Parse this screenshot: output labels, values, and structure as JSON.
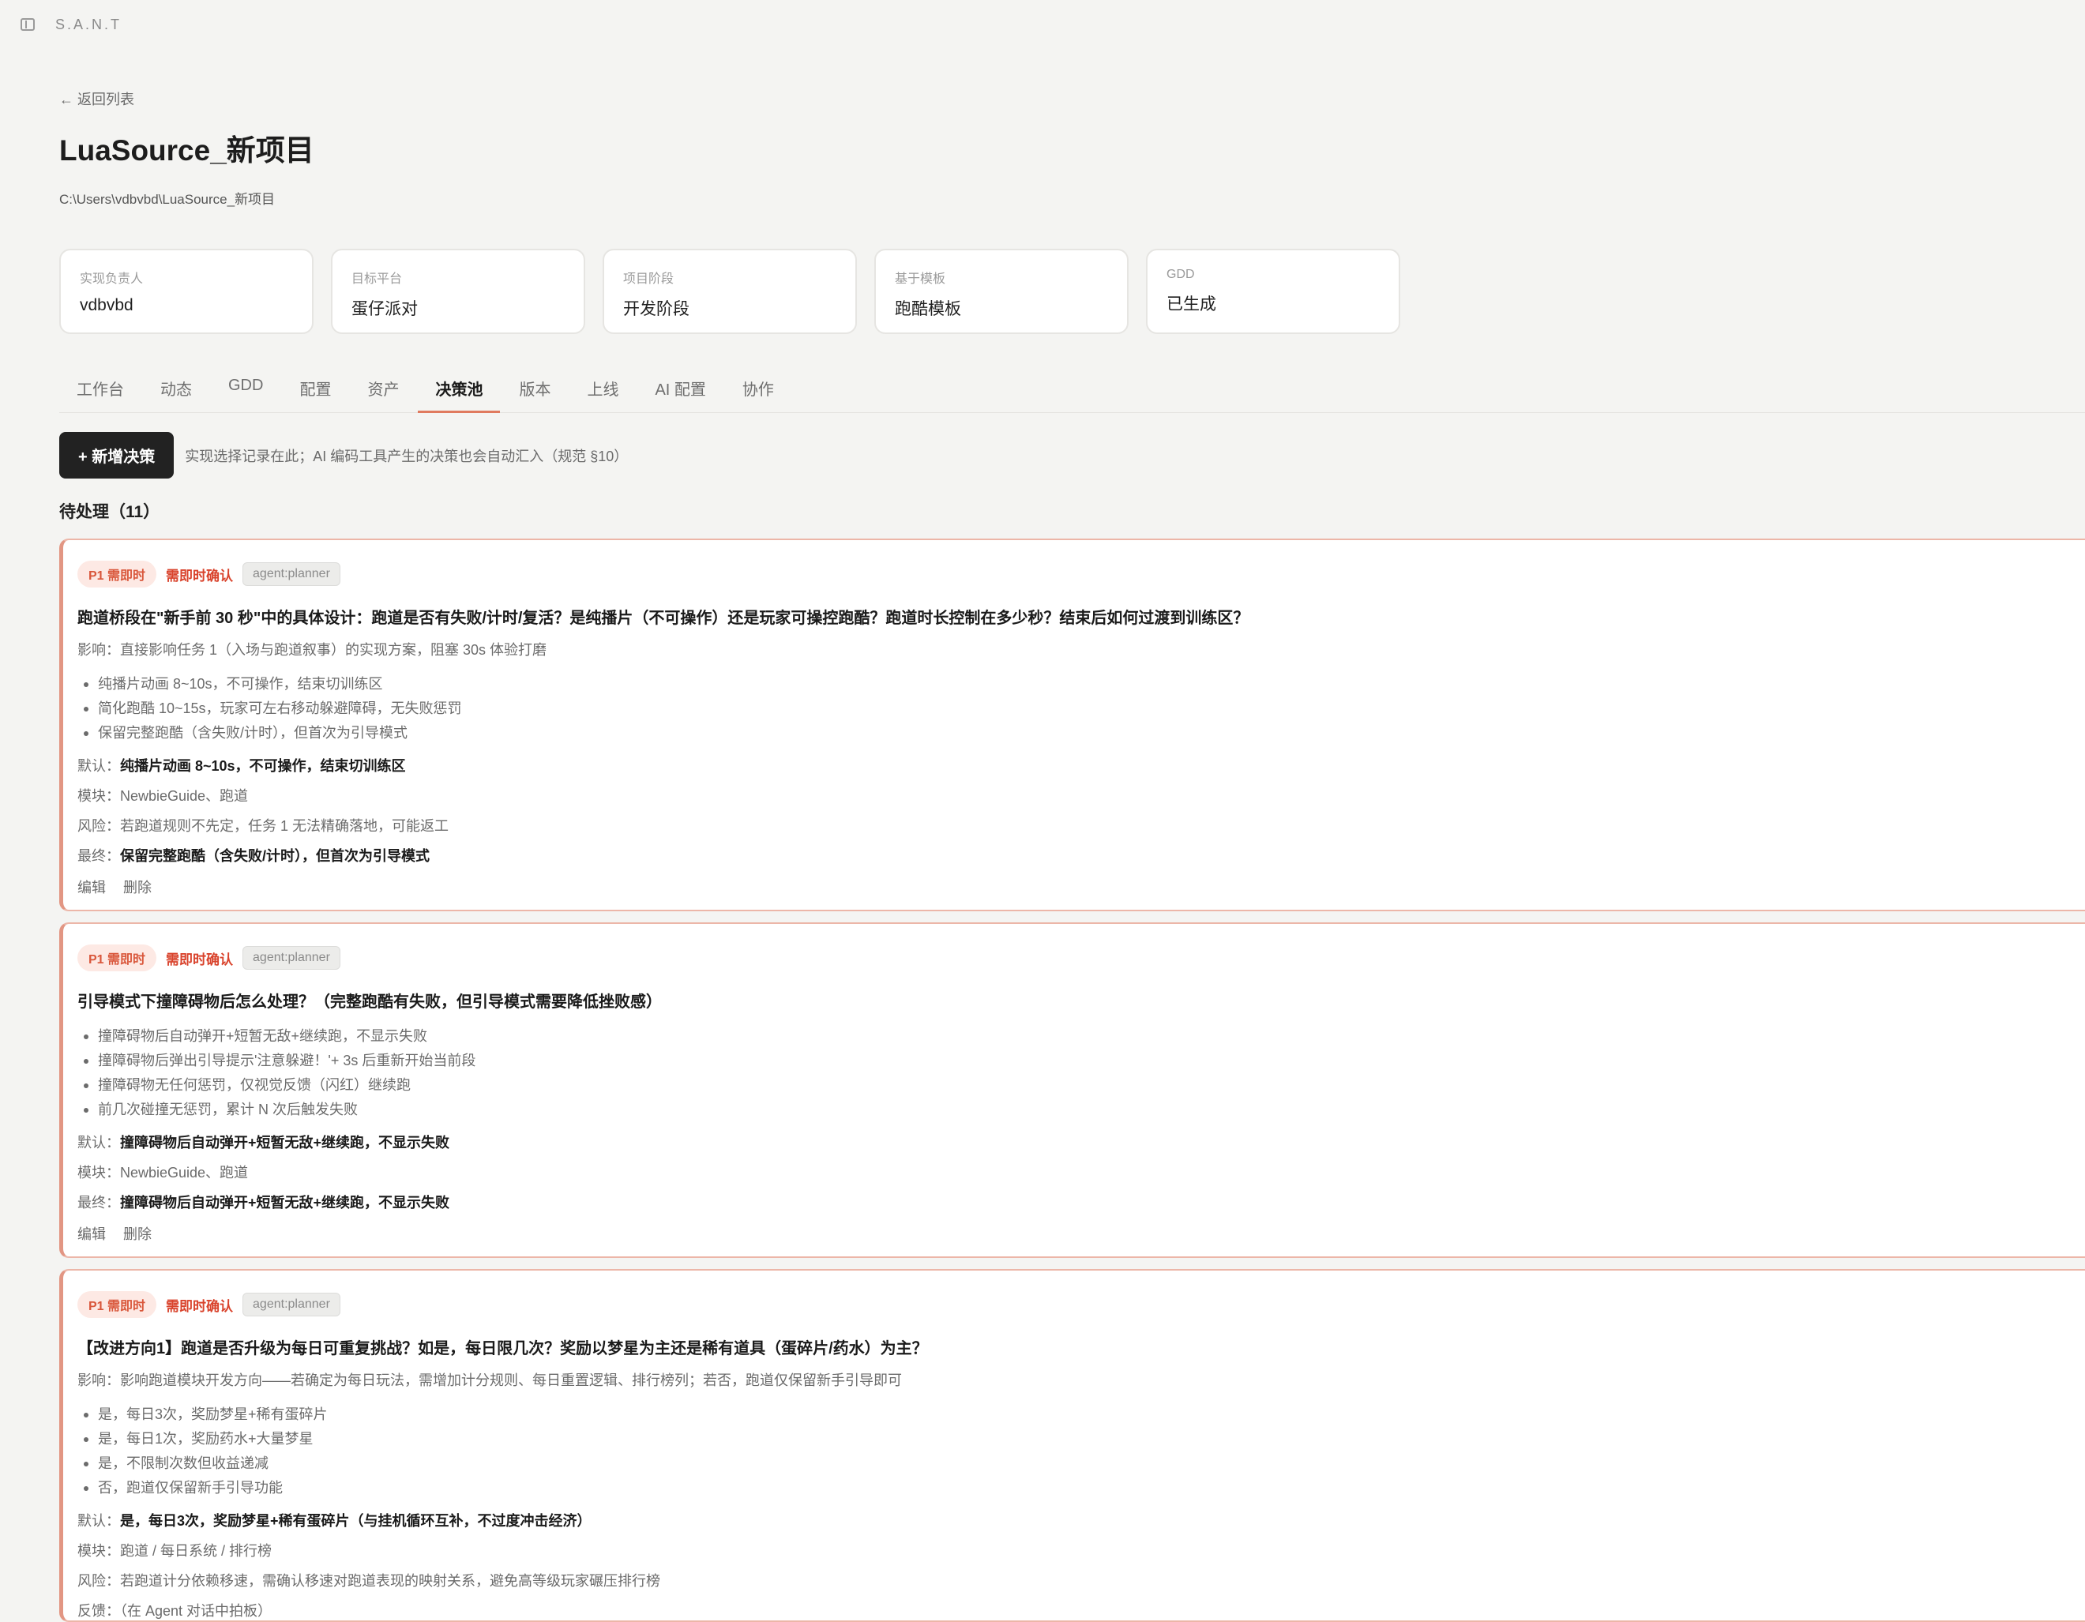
{
  "app": {
    "brand": "S.A.N.T"
  },
  "nav": {
    "back": "← 返回列表"
  },
  "project": {
    "title": "LuaSource_新项目",
    "path": "C:\\Users\\vdbvbd\\LuaSource_新项目"
  },
  "cards": [
    {
      "label": "实现负责人",
      "value": "vdbvbd"
    },
    {
      "label": "目标平台",
      "value": "蛋仔派对"
    },
    {
      "label": "项目阶段",
      "value": "开发阶段"
    },
    {
      "label": "基于模板",
      "value": "跑酷模板"
    },
    {
      "label": "GDD",
      "value": "已生成"
    }
  ],
  "tabs": [
    "工作台",
    "动态",
    "GDD",
    "配置",
    "资产",
    "决策池",
    "版本",
    "上线",
    "AI 配置",
    "协作"
  ],
  "active_tab": "决策池",
  "toolbar": {
    "add_label": "+ 新增决策",
    "hint": "实现选择记录在此；AI 编码工具产生的决策也会自动汇入（规范 §10）"
  },
  "section": {
    "pending": "待处理（11）"
  },
  "labels": {
    "impact": "影响：",
    "default": "默认：",
    "module": "模块：",
    "risk": "风险：",
    "final": "最终：",
    "feedback": "反馈：",
    "edit": "编辑",
    "delete": "删除"
  },
  "decisions": [
    {
      "priority": "P1 需即时",
      "status": "需即时确认",
      "agent": "agent:planner",
      "question": "跑道桥段在\"新手前 30 秒\"中的具体设计：跑道是否有失败/计时/复活？是纯播片（不可操作）还是玩家可操控跑酷？跑道时长控制在多少秒？结束后如何过渡到训练区？",
      "impact": "直接影响任务 1（入场与跑道叙事）的实现方案，阻塞 30s 体验打磨",
      "options": [
        "纯播片动画 8~10s，不可操作，结束切训练区",
        "简化跑酷 10~15s，玩家可左右移动躲避障碍，无失败惩罚",
        "保留完整跑酷（含失败/计时），但首次为引导模式"
      ],
      "default": "纯播片动画 8~10s，不可操作，结束切训练区",
      "module": "NewbieGuide、跑道",
      "risk": "若跑道规则不先定，任务 1 无法精确落地，可能返工",
      "final": "保留完整跑酷（含失败/计时），但首次为引导模式"
    },
    {
      "priority": "P1 需即时",
      "status": "需即时确认",
      "agent": "agent:planner",
      "question": "引导模式下撞障碍物后怎么处理？（完整跑酷有失败，但引导模式需要降低挫败感）",
      "options": [
        "撞障碍物后自动弹开+短暂无敌+继续跑，不显示失败",
        "撞障碍物后弹出引导提示'注意躲避！'+ 3s 后重新开始当前段",
        "撞障碍物无任何惩罚，仅视觉反馈（闪红）继续跑",
        "前几次碰撞无惩罚，累计 N 次后触发失败"
      ],
      "default": "撞障碍物后自动弹开+短暂无敌+继续跑，不显示失败",
      "module": "NewbieGuide、跑道",
      "final": "撞障碍物后自动弹开+短暂无敌+继续跑，不显示失败"
    },
    {
      "priority": "P1 需即时",
      "status": "需即时确认",
      "agent": "agent:planner",
      "question": "【改进方向1】跑道是否升级为每日可重复挑战？如是，每日限几次？奖励以梦星为主还是稀有道具（蛋碎片/药水）为主？",
      "impact": "影响跑道模块开发方向——若确定为每日玩法，需增加计分规则、每日重置逻辑、排行榜列；若否，跑道仅保留新手引导即可",
      "options": [
        "是，每日3次，奖励梦星+稀有蛋碎片",
        "是，每日1次，奖励药水+大量梦星",
        "是，不限制次数但收益递减",
        "否，跑道仅保留新手引导功能"
      ],
      "default": "是，每日3次，奖励梦星+稀有蛋碎片（与挂机循环互补，不过度冲击经济）",
      "module": "跑道 / 每日系统 / 排行榜",
      "risk": "若跑道计分依赖移速，需确认移速对跑道表现的映射关系，避免高等级玩家碾压排行榜",
      "feedback": "（在 Agent 对话中拍板）"
    }
  ]
}
